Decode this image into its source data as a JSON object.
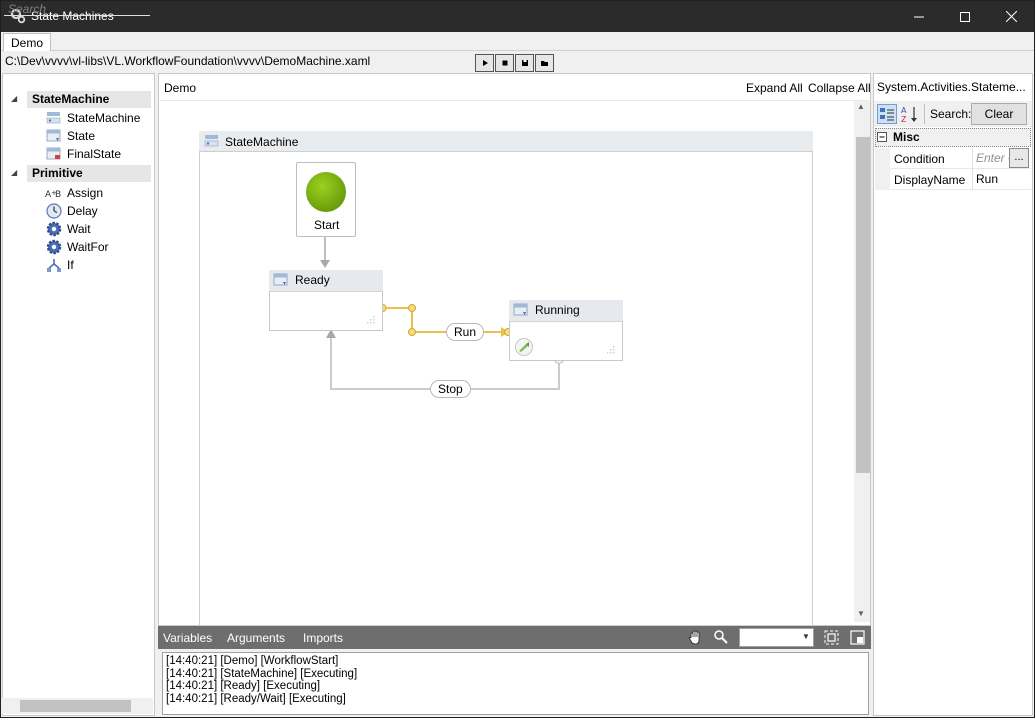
{
  "window": {
    "title": "State Machines",
    "controls": {
      "minimize": "—",
      "maximize": "☐",
      "close": "✕"
    }
  },
  "tabs": [
    {
      "label": "Demo"
    }
  ],
  "path": "C:\\Dev\\vvvv\\vl-libs\\VL.WorkflowFoundation\\vvvv\\DemoMachine.xaml",
  "run_toolbar": [
    "play-icon",
    "stop-icon",
    "save-icon",
    "open-icon"
  ],
  "toolbox": {
    "search_placeholder": "Search",
    "categories": [
      {
        "label": "StateMachine",
        "items": [
          {
            "label": "StateMachine",
            "icon": "statemachine-icon"
          },
          {
            "label": "State",
            "icon": "state-icon"
          },
          {
            "label": "FinalState",
            "icon": "finalstate-icon"
          }
        ]
      },
      {
        "label": "Primitive",
        "items": [
          {
            "label": "Assign",
            "icon": "assign-icon"
          },
          {
            "label": "Delay",
            "icon": "clock-icon"
          },
          {
            "label": "Wait",
            "icon": "gear-icon"
          },
          {
            "label": "WaitFor",
            "icon": "gear-icon"
          },
          {
            "label": "If",
            "icon": "if-icon"
          }
        ]
      }
    ]
  },
  "designer": {
    "breadcrumb": "Demo",
    "expand_all": "Expand All",
    "collapse_all": "Collapse All",
    "container_title": "StateMachine",
    "start_label": "Start",
    "states": [
      {
        "name": "Ready"
      },
      {
        "name": "Running"
      }
    ],
    "transitions": [
      {
        "label": "Run"
      },
      {
        "label": "Stop"
      }
    ]
  },
  "bottom_tabs": {
    "variables": "Variables",
    "arguments": "Arguments",
    "imports": "Imports"
  },
  "log": [
    "[14:40:21] [Demo] [WorkflowStart]",
    "[14:40:21] [StateMachine] [Executing]",
    "[14:40:21] [Ready] [Executing]",
    "[14:40:21] [Ready/Wait] [Executing]"
  ],
  "properties": {
    "title": "System.Activities.Stateme...",
    "search_label": "Search:",
    "clear_label": "Clear",
    "category": "Misc",
    "rows": [
      {
        "name": "Condition",
        "value_placeholder": "Enter C"
      },
      {
        "name": "DisplayName",
        "value": "Run"
      }
    ],
    "ellipsis": "..."
  },
  "colors": {
    "titlebar": "#2b2b2b",
    "transition_selected": "#e8c24a",
    "start_green": "#7db514",
    "bottom_bar": "#6e6e6e"
  }
}
